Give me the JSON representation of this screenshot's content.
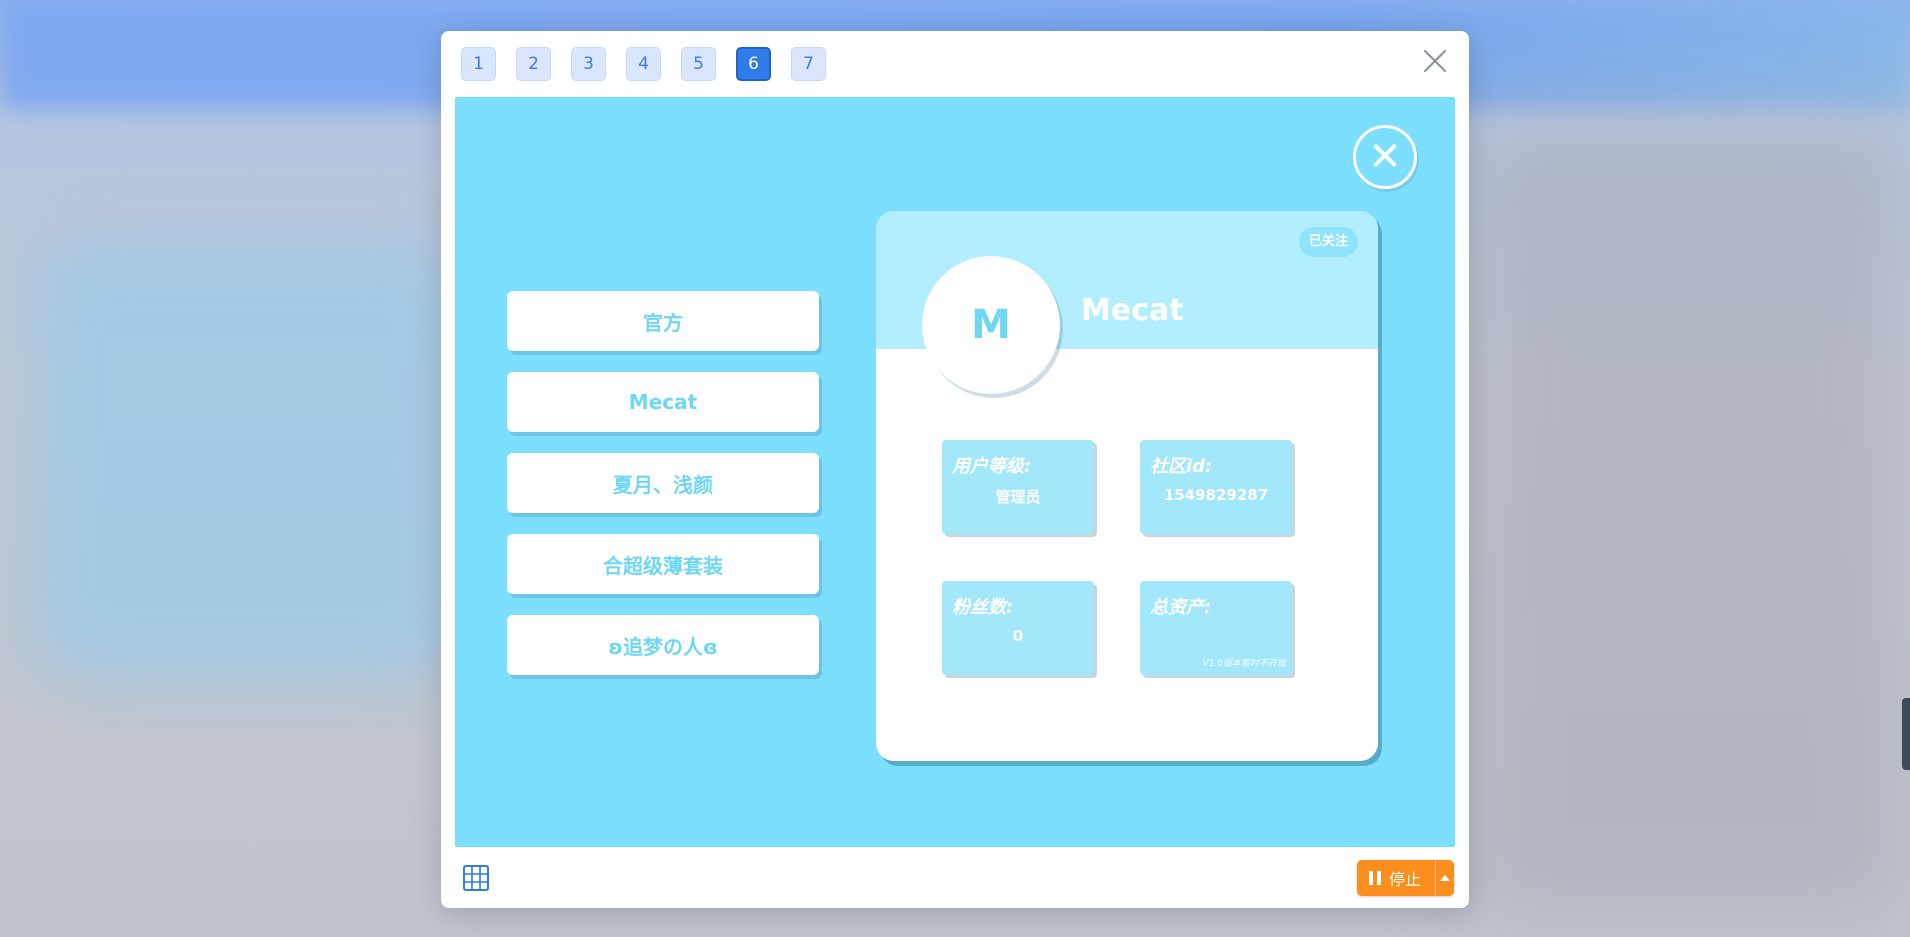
{
  "pager": {
    "pages": [
      "1",
      "2",
      "3",
      "4",
      "5",
      "6",
      "7"
    ],
    "active": "6"
  },
  "stage": {
    "close_symbol": "✕",
    "menu": [
      "官方",
      "Mecat",
      "夏月、浅颜",
      "合超级薄套装",
      "ʚ追梦の人ɞ"
    ],
    "profile": {
      "follow_label": "已关注",
      "avatar_letter": "M",
      "username": "Mecat",
      "stats": {
        "level": {
          "label": "用户等级:",
          "value": "管理员"
        },
        "community_id": {
          "label": "社区id:",
          "value": "1549829287"
        },
        "fans": {
          "label": "粉丝数:",
          "value": "0"
        },
        "assets": {
          "label": "总资产:",
          "value": "",
          "note": "V1.0版本暂时不开放"
        }
      }
    }
  },
  "footer": {
    "stop_label": "停止"
  },
  "colors": {
    "stage_bg": "#7ddffe",
    "active_page": "#2f7be9",
    "stop_button": "#fb8e1c",
    "text_accent": "#6fd6f3"
  }
}
